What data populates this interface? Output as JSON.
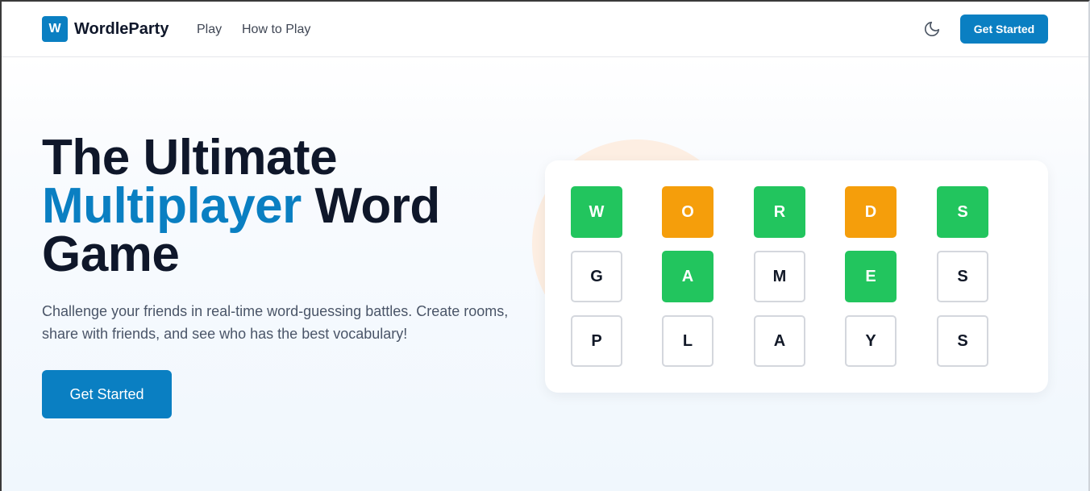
{
  "header": {
    "logo_letter": "W",
    "brand": "WordleParty",
    "nav": [
      "Play",
      "How to Play"
    ],
    "theme_icon": "moon-icon",
    "cta": "Get Started"
  },
  "hero": {
    "title_line1": "The Ultimate",
    "title_accent": "Multiplayer",
    "title_word": "Word",
    "title_line3": "Game",
    "description": "Challenge your friends in real-time word-guessing battles. Create rooms, share with friends, and see who has the best vocabulary!",
    "cta": "Get Started"
  },
  "board": {
    "rows": [
      [
        {
          "l": "W",
          "s": "green"
        },
        {
          "l": "O",
          "s": "orange"
        },
        {
          "l": "R",
          "s": "green"
        },
        {
          "l": "D",
          "s": "orange"
        },
        {
          "l": "S",
          "s": "green"
        }
      ],
      [
        {
          "l": "G",
          "s": "empty"
        },
        {
          "l": "A",
          "s": "green"
        },
        {
          "l": "M",
          "s": "empty"
        },
        {
          "l": "E",
          "s": "green"
        },
        {
          "l": "S",
          "s": "empty"
        }
      ],
      [
        {
          "l": "P",
          "s": "empty"
        },
        {
          "l": "L",
          "s": "empty"
        },
        {
          "l": "A",
          "s": "empty"
        },
        {
          "l": "Y",
          "s": "empty"
        },
        {
          "l": "S",
          "s": "empty"
        }
      ]
    ]
  },
  "colors": {
    "brand": "#0a7fc2",
    "tile_green": "#22c55e",
    "tile_orange": "#f59e0b",
    "heading": "#0f172a"
  }
}
